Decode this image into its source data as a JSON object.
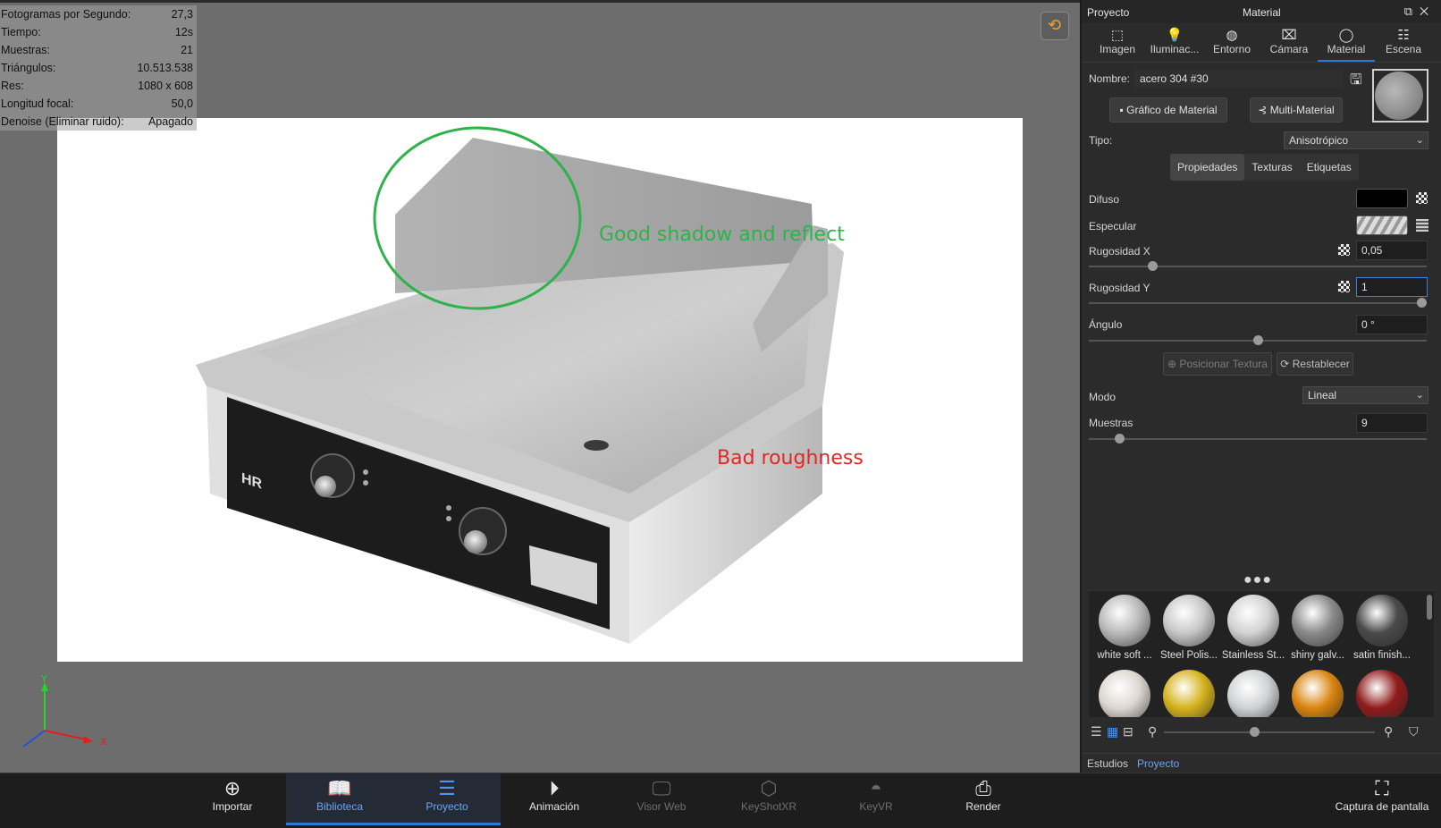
{
  "stats": [
    {
      "label": "Fotogramas por Segundo:",
      "value": "27,3"
    },
    {
      "label": "Tiempo:",
      "value": "12s"
    },
    {
      "label": "Muestras:",
      "value": "21"
    },
    {
      "label": "Triángulos:",
      "value": "10.513.538"
    },
    {
      "label": "Res:",
      "value": "1080 x 608"
    },
    {
      "label": "Longitud focal:",
      "value": "50,0"
    },
    {
      "label": "Denoise (Eliminar ruido):",
      "value": "Apagado"
    }
  ],
  "annotations": {
    "good": "Good shadow and reflect",
    "bad": "Bad roughness"
  },
  "colors": {
    "good": "#2db34a",
    "bad": "#e02828",
    "accent": "#2d7ad6"
  },
  "axis": {
    "y": "Y",
    "x": "X"
  },
  "product": {
    "logo": "HR"
  },
  "panel": {
    "left_title": "Proyecto",
    "title": "Material",
    "tabs": [
      {
        "label": "Imagen",
        "icon": "image-icon"
      },
      {
        "label": "Iluminac...",
        "icon": "bulb-icon"
      },
      {
        "label": "Entorno",
        "icon": "globe-icon"
      },
      {
        "label": "Cámara",
        "icon": "camera-icon"
      },
      {
        "label": "Material",
        "icon": "material-icon"
      },
      {
        "label": "Escena",
        "icon": "scene-icon"
      }
    ],
    "name_label": "Nombre:",
    "name_value": "acero 304 #30",
    "graph_button": "Gráfico de Material",
    "multi_button": "Multi-Material",
    "tipo_label": "Tipo:",
    "tipo_value": "Anisotrópico",
    "subtabs": [
      "Propiedades",
      "Texturas",
      "Etiquetas"
    ],
    "difuso_label": "Difuso",
    "especular_label": "Especular",
    "rough_x_label": "Rugosidad X",
    "rough_x_value": "0,05",
    "rough_y_label": "Rugosidad Y",
    "rough_y_value": "1",
    "angle_label": "Ángulo",
    "angle_value": "0 °",
    "position_button": "Posicionar Textura",
    "reset_button": "Restablecer",
    "modo_label": "Modo",
    "modo_value": "Lineal",
    "muestras_label": "Muestras",
    "muestras_value": "9",
    "sliders": {
      "rough_x": 0.18,
      "rough_y": 1.0,
      "angle": 0.5,
      "muestras": 0.08
    }
  },
  "library": {
    "items": [
      {
        "label": "white soft ...",
        "color": "#b9b9b9"
      },
      {
        "label": "Steel Polis...",
        "color": "#c8c8c8"
      },
      {
        "label": "Stainless St...",
        "color": "#d2d2d2"
      },
      {
        "label": "shiny galv...",
        "color": "#8a8a8a"
      },
      {
        "label": "satin finish...",
        "color": "#4a4a4a"
      },
      {
        "label": "",
        "color": "#ddd7d0"
      },
      {
        "label": "",
        "color": "#d4b21c"
      },
      {
        "label": "",
        "color": "#cfd2d4"
      },
      {
        "label": "",
        "color": "#d9840f"
      },
      {
        "label": "",
        "color": "#8f1b1b"
      }
    ],
    "tabs": [
      "Estudios",
      "Proyecto"
    ]
  },
  "toolbar": {
    "items": [
      {
        "label": "Importar",
        "icon": "import-icon"
      },
      {
        "label": "Biblioteca",
        "icon": "book-icon"
      },
      {
        "label": "Proyecto",
        "icon": "list-icon"
      },
      {
        "label": "Animación",
        "icon": "play-icon"
      },
      {
        "label": "Visor Web",
        "icon": "monitor-icon"
      },
      {
        "label": "KeyShotXR",
        "icon": "cube-icon"
      },
      {
        "label": "KeyVR",
        "icon": "vr-icon"
      },
      {
        "label": "Render",
        "icon": "render-icon"
      }
    ],
    "screenshot": "Captura de pantalla"
  }
}
